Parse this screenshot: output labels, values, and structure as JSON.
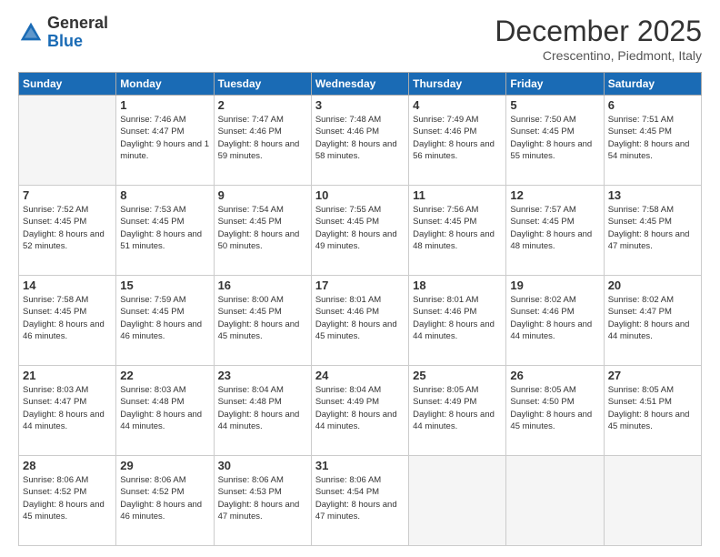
{
  "header": {
    "logo_general": "General",
    "logo_blue": "Blue",
    "month_title": "December 2025",
    "location": "Crescentino, Piedmont, Italy"
  },
  "weekdays": [
    "Sunday",
    "Monday",
    "Tuesday",
    "Wednesday",
    "Thursday",
    "Friday",
    "Saturday"
  ],
  "weeks": [
    [
      {
        "day": "",
        "sunrise": "",
        "sunset": "",
        "daylight": ""
      },
      {
        "day": "1",
        "sunrise": "Sunrise: 7:46 AM",
        "sunset": "Sunset: 4:47 PM",
        "daylight": "Daylight: 9 hours and 1 minute."
      },
      {
        "day": "2",
        "sunrise": "Sunrise: 7:47 AM",
        "sunset": "Sunset: 4:46 PM",
        "daylight": "Daylight: 8 hours and 59 minutes."
      },
      {
        "day": "3",
        "sunrise": "Sunrise: 7:48 AM",
        "sunset": "Sunset: 4:46 PM",
        "daylight": "Daylight: 8 hours and 58 minutes."
      },
      {
        "day": "4",
        "sunrise": "Sunrise: 7:49 AM",
        "sunset": "Sunset: 4:46 PM",
        "daylight": "Daylight: 8 hours and 56 minutes."
      },
      {
        "day": "5",
        "sunrise": "Sunrise: 7:50 AM",
        "sunset": "Sunset: 4:45 PM",
        "daylight": "Daylight: 8 hours and 55 minutes."
      },
      {
        "day": "6",
        "sunrise": "Sunrise: 7:51 AM",
        "sunset": "Sunset: 4:45 PM",
        "daylight": "Daylight: 8 hours and 54 minutes."
      }
    ],
    [
      {
        "day": "7",
        "sunrise": "Sunrise: 7:52 AM",
        "sunset": "Sunset: 4:45 PM",
        "daylight": "Daylight: 8 hours and 52 minutes."
      },
      {
        "day": "8",
        "sunrise": "Sunrise: 7:53 AM",
        "sunset": "Sunset: 4:45 PM",
        "daylight": "Daylight: 8 hours and 51 minutes."
      },
      {
        "day": "9",
        "sunrise": "Sunrise: 7:54 AM",
        "sunset": "Sunset: 4:45 PM",
        "daylight": "Daylight: 8 hours and 50 minutes."
      },
      {
        "day": "10",
        "sunrise": "Sunrise: 7:55 AM",
        "sunset": "Sunset: 4:45 PM",
        "daylight": "Daylight: 8 hours and 49 minutes."
      },
      {
        "day": "11",
        "sunrise": "Sunrise: 7:56 AM",
        "sunset": "Sunset: 4:45 PM",
        "daylight": "Daylight: 8 hours and 48 minutes."
      },
      {
        "day": "12",
        "sunrise": "Sunrise: 7:57 AM",
        "sunset": "Sunset: 4:45 PM",
        "daylight": "Daylight: 8 hours and 48 minutes."
      },
      {
        "day": "13",
        "sunrise": "Sunrise: 7:58 AM",
        "sunset": "Sunset: 4:45 PM",
        "daylight": "Daylight: 8 hours and 47 minutes."
      }
    ],
    [
      {
        "day": "14",
        "sunrise": "Sunrise: 7:58 AM",
        "sunset": "Sunset: 4:45 PM",
        "daylight": "Daylight: 8 hours and 46 minutes."
      },
      {
        "day": "15",
        "sunrise": "Sunrise: 7:59 AM",
        "sunset": "Sunset: 4:45 PM",
        "daylight": "Daylight: 8 hours and 46 minutes."
      },
      {
        "day": "16",
        "sunrise": "Sunrise: 8:00 AM",
        "sunset": "Sunset: 4:45 PM",
        "daylight": "Daylight: 8 hours and 45 minutes."
      },
      {
        "day": "17",
        "sunrise": "Sunrise: 8:01 AM",
        "sunset": "Sunset: 4:46 PM",
        "daylight": "Daylight: 8 hours and 45 minutes."
      },
      {
        "day": "18",
        "sunrise": "Sunrise: 8:01 AM",
        "sunset": "Sunset: 4:46 PM",
        "daylight": "Daylight: 8 hours and 44 minutes."
      },
      {
        "day": "19",
        "sunrise": "Sunrise: 8:02 AM",
        "sunset": "Sunset: 4:46 PM",
        "daylight": "Daylight: 8 hours and 44 minutes."
      },
      {
        "day": "20",
        "sunrise": "Sunrise: 8:02 AM",
        "sunset": "Sunset: 4:47 PM",
        "daylight": "Daylight: 8 hours and 44 minutes."
      }
    ],
    [
      {
        "day": "21",
        "sunrise": "Sunrise: 8:03 AM",
        "sunset": "Sunset: 4:47 PM",
        "daylight": "Daylight: 8 hours and 44 minutes."
      },
      {
        "day": "22",
        "sunrise": "Sunrise: 8:03 AM",
        "sunset": "Sunset: 4:48 PM",
        "daylight": "Daylight: 8 hours and 44 minutes."
      },
      {
        "day": "23",
        "sunrise": "Sunrise: 8:04 AM",
        "sunset": "Sunset: 4:48 PM",
        "daylight": "Daylight: 8 hours and 44 minutes."
      },
      {
        "day": "24",
        "sunrise": "Sunrise: 8:04 AM",
        "sunset": "Sunset: 4:49 PM",
        "daylight": "Daylight: 8 hours and 44 minutes."
      },
      {
        "day": "25",
        "sunrise": "Sunrise: 8:05 AM",
        "sunset": "Sunset: 4:49 PM",
        "daylight": "Daylight: 8 hours and 44 minutes."
      },
      {
        "day": "26",
        "sunrise": "Sunrise: 8:05 AM",
        "sunset": "Sunset: 4:50 PM",
        "daylight": "Daylight: 8 hours and 45 minutes."
      },
      {
        "day": "27",
        "sunrise": "Sunrise: 8:05 AM",
        "sunset": "Sunset: 4:51 PM",
        "daylight": "Daylight: 8 hours and 45 minutes."
      }
    ],
    [
      {
        "day": "28",
        "sunrise": "Sunrise: 8:06 AM",
        "sunset": "Sunset: 4:52 PM",
        "daylight": "Daylight: 8 hours and 45 minutes."
      },
      {
        "day": "29",
        "sunrise": "Sunrise: 8:06 AM",
        "sunset": "Sunset: 4:52 PM",
        "daylight": "Daylight: 8 hours and 46 minutes."
      },
      {
        "day": "30",
        "sunrise": "Sunrise: 8:06 AM",
        "sunset": "Sunset: 4:53 PM",
        "daylight": "Daylight: 8 hours and 47 minutes."
      },
      {
        "day": "31",
        "sunrise": "Sunrise: 8:06 AM",
        "sunset": "Sunset: 4:54 PM",
        "daylight": "Daylight: 8 hours and 47 minutes."
      },
      {
        "day": "",
        "sunrise": "",
        "sunset": "",
        "daylight": ""
      },
      {
        "day": "",
        "sunrise": "",
        "sunset": "",
        "daylight": ""
      },
      {
        "day": "",
        "sunrise": "",
        "sunset": "",
        "daylight": ""
      }
    ]
  ]
}
